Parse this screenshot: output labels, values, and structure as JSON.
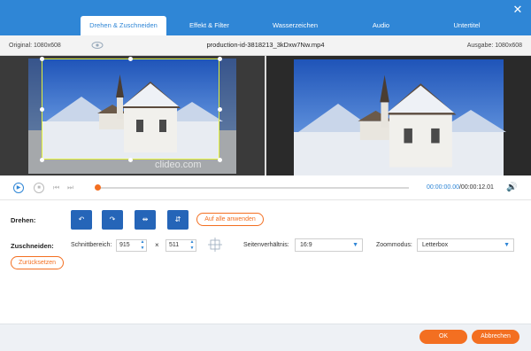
{
  "tabs": [
    {
      "label": "Drehen & Zuschneiden"
    },
    {
      "label": "Effekt & Filter"
    },
    {
      "label": "Wasserzeichen"
    },
    {
      "label": "Audio"
    },
    {
      "label": "Untertitel"
    }
  ],
  "active_tab": 0,
  "window": {
    "close_icon": "close-icon"
  },
  "info": {
    "original": "Original: 1080x608",
    "filename": "production-id-3818213_3kDxw7Nw.mp4",
    "output": "Ausgabe: 1080x608"
  },
  "preview": {
    "watermark": "clideo.com"
  },
  "player": {
    "current_time": "00:00:00.00",
    "total_time": "/00:00:12.01",
    "time_display": "00:00:00.00/00:00:12.01",
    "progress": 0.0
  },
  "rotate": {
    "label": "Drehen:",
    "buttons": [
      {
        "icon": "rotate-left-icon",
        "glyph": "↶"
      },
      {
        "icon": "rotate-right-icon",
        "glyph": "↷"
      },
      {
        "icon": "flip-horizontal-icon",
        "glyph": "⇹"
      },
      {
        "icon": "flip-vertical-icon",
        "glyph": "⇵"
      }
    ],
    "apply_all": "Auf alle anwenden"
  },
  "crop": {
    "label": "Zuschneiden:",
    "area_label": "Schnittbereich:",
    "width": "915",
    "times": "×",
    "height": "511",
    "aspect_label": "Seitenverhältnis:",
    "aspect_value": "16:9",
    "zoom_label": "Zoommodus:",
    "zoom_value": "Letterbox",
    "reset": "Zurücksetzen"
  },
  "footer": {
    "ok": "OK",
    "cancel": "Abbrechen"
  },
  "colors": {
    "accent": "#2f86d6",
    "orange": "#f36f21",
    "crop_border": "#e4f23a"
  }
}
